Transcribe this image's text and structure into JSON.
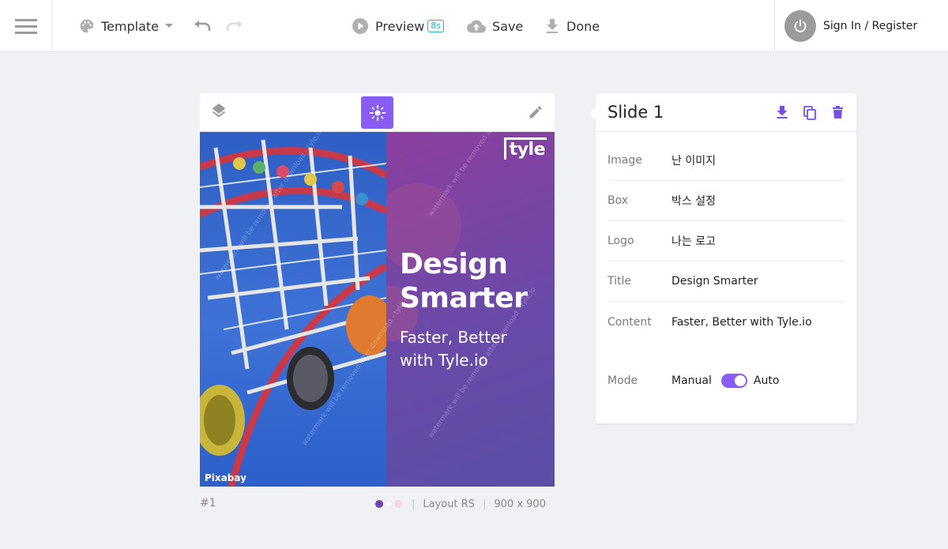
{
  "topbar": {
    "template_label": "Template",
    "preview_label": "Preview",
    "preview_badge": "8s",
    "save_label": "Save",
    "done_label": "Done",
    "signin_label": "Sign In / Register"
  },
  "canvas": {
    "brand": "tyle",
    "title_line1": "Design",
    "title_line2": "Smarter",
    "content_line1": "Faster, Better",
    "content_line2": "with Tyle.io",
    "credit": "Pixabay",
    "watermark": "watermark will be removed after download - tyle.io",
    "card_number": "#1",
    "layout": "Layout RS",
    "size": "900 x 900",
    "swatches": [
      "#6b45b5",
      "#ffffff",
      "#f3d6e6"
    ]
  },
  "panel": {
    "title": "Slide 1",
    "rows": [
      {
        "label": "Image",
        "value": "난 이미지"
      },
      {
        "label": "Box",
        "value": "박스 설정"
      },
      {
        "label": "Logo",
        "value": "나는 로고"
      },
      {
        "label": "Title",
        "value": "Design Smarter"
      },
      {
        "label": "Content",
        "value": "Faster, Better with Tyle.io"
      }
    ],
    "mode": {
      "label": "Mode",
      "left": "Manual",
      "right": "Auto",
      "state": "Auto"
    }
  },
  "colors": {
    "accent": "#8a5cf6",
    "badge": "#19b5d1",
    "panel_icons": "#7b4ee8"
  }
}
